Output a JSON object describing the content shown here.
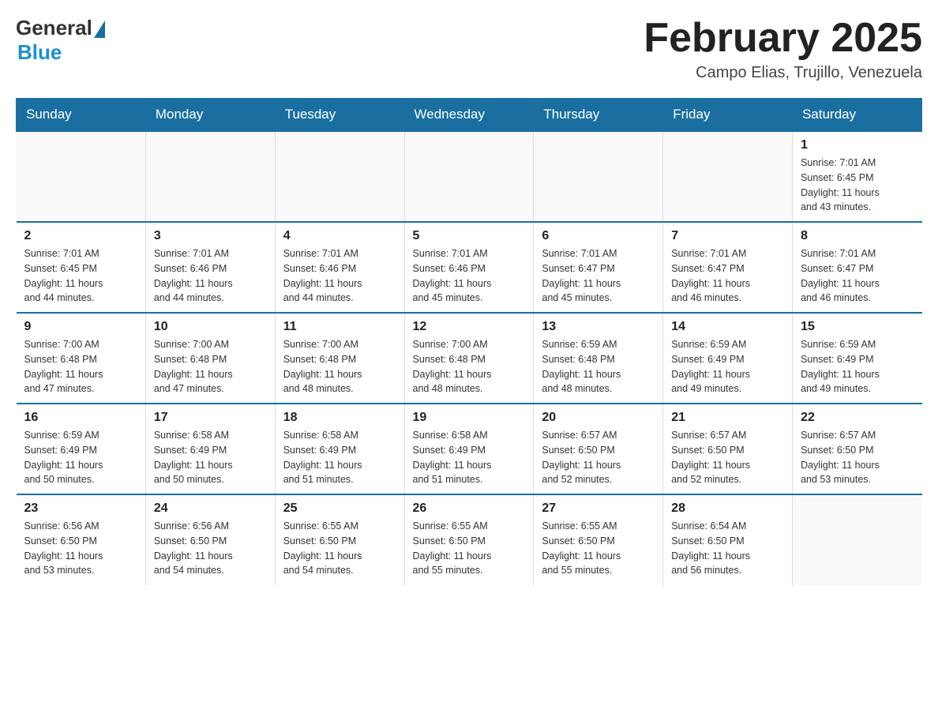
{
  "header": {
    "logo_general": "General",
    "logo_blue": "Blue",
    "title": "February 2025",
    "subtitle": "Campo Elias, Trujillo, Venezuela"
  },
  "weekdays": [
    "Sunday",
    "Monday",
    "Tuesday",
    "Wednesday",
    "Thursday",
    "Friday",
    "Saturday"
  ],
  "weeks": [
    [
      {
        "day": "",
        "info": ""
      },
      {
        "day": "",
        "info": ""
      },
      {
        "day": "",
        "info": ""
      },
      {
        "day": "",
        "info": ""
      },
      {
        "day": "",
        "info": ""
      },
      {
        "day": "",
        "info": ""
      },
      {
        "day": "1",
        "info": "Sunrise: 7:01 AM\nSunset: 6:45 PM\nDaylight: 11 hours\nand 43 minutes."
      }
    ],
    [
      {
        "day": "2",
        "info": "Sunrise: 7:01 AM\nSunset: 6:45 PM\nDaylight: 11 hours\nand 44 minutes."
      },
      {
        "day": "3",
        "info": "Sunrise: 7:01 AM\nSunset: 6:46 PM\nDaylight: 11 hours\nand 44 minutes."
      },
      {
        "day": "4",
        "info": "Sunrise: 7:01 AM\nSunset: 6:46 PM\nDaylight: 11 hours\nand 44 minutes."
      },
      {
        "day": "5",
        "info": "Sunrise: 7:01 AM\nSunset: 6:46 PM\nDaylight: 11 hours\nand 45 minutes."
      },
      {
        "day": "6",
        "info": "Sunrise: 7:01 AM\nSunset: 6:47 PM\nDaylight: 11 hours\nand 45 minutes."
      },
      {
        "day": "7",
        "info": "Sunrise: 7:01 AM\nSunset: 6:47 PM\nDaylight: 11 hours\nand 46 minutes."
      },
      {
        "day": "8",
        "info": "Sunrise: 7:01 AM\nSunset: 6:47 PM\nDaylight: 11 hours\nand 46 minutes."
      }
    ],
    [
      {
        "day": "9",
        "info": "Sunrise: 7:00 AM\nSunset: 6:48 PM\nDaylight: 11 hours\nand 47 minutes."
      },
      {
        "day": "10",
        "info": "Sunrise: 7:00 AM\nSunset: 6:48 PM\nDaylight: 11 hours\nand 47 minutes."
      },
      {
        "day": "11",
        "info": "Sunrise: 7:00 AM\nSunset: 6:48 PM\nDaylight: 11 hours\nand 48 minutes."
      },
      {
        "day": "12",
        "info": "Sunrise: 7:00 AM\nSunset: 6:48 PM\nDaylight: 11 hours\nand 48 minutes."
      },
      {
        "day": "13",
        "info": "Sunrise: 6:59 AM\nSunset: 6:48 PM\nDaylight: 11 hours\nand 48 minutes."
      },
      {
        "day": "14",
        "info": "Sunrise: 6:59 AM\nSunset: 6:49 PM\nDaylight: 11 hours\nand 49 minutes."
      },
      {
        "day": "15",
        "info": "Sunrise: 6:59 AM\nSunset: 6:49 PM\nDaylight: 11 hours\nand 49 minutes."
      }
    ],
    [
      {
        "day": "16",
        "info": "Sunrise: 6:59 AM\nSunset: 6:49 PM\nDaylight: 11 hours\nand 50 minutes."
      },
      {
        "day": "17",
        "info": "Sunrise: 6:58 AM\nSunset: 6:49 PM\nDaylight: 11 hours\nand 50 minutes."
      },
      {
        "day": "18",
        "info": "Sunrise: 6:58 AM\nSunset: 6:49 PM\nDaylight: 11 hours\nand 51 minutes."
      },
      {
        "day": "19",
        "info": "Sunrise: 6:58 AM\nSunset: 6:49 PM\nDaylight: 11 hours\nand 51 minutes."
      },
      {
        "day": "20",
        "info": "Sunrise: 6:57 AM\nSunset: 6:50 PM\nDaylight: 11 hours\nand 52 minutes."
      },
      {
        "day": "21",
        "info": "Sunrise: 6:57 AM\nSunset: 6:50 PM\nDaylight: 11 hours\nand 52 minutes."
      },
      {
        "day": "22",
        "info": "Sunrise: 6:57 AM\nSunset: 6:50 PM\nDaylight: 11 hours\nand 53 minutes."
      }
    ],
    [
      {
        "day": "23",
        "info": "Sunrise: 6:56 AM\nSunset: 6:50 PM\nDaylight: 11 hours\nand 53 minutes."
      },
      {
        "day": "24",
        "info": "Sunrise: 6:56 AM\nSunset: 6:50 PM\nDaylight: 11 hours\nand 54 minutes."
      },
      {
        "day": "25",
        "info": "Sunrise: 6:55 AM\nSunset: 6:50 PM\nDaylight: 11 hours\nand 54 minutes."
      },
      {
        "day": "26",
        "info": "Sunrise: 6:55 AM\nSunset: 6:50 PM\nDaylight: 11 hours\nand 55 minutes."
      },
      {
        "day": "27",
        "info": "Sunrise: 6:55 AM\nSunset: 6:50 PM\nDaylight: 11 hours\nand 55 minutes."
      },
      {
        "day": "28",
        "info": "Sunrise: 6:54 AM\nSunset: 6:50 PM\nDaylight: 11 hours\nand 56 minutes."
      },
      {
        "day": "",
        "info": ""
      }
    ]
  ]
}
